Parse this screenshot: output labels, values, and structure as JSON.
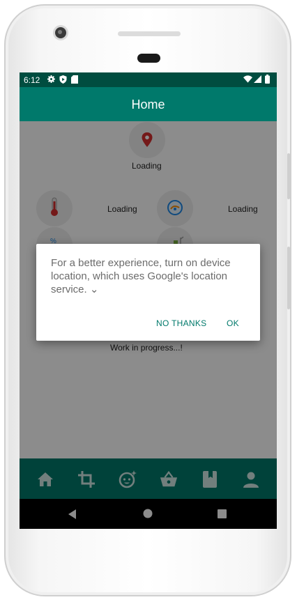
{
  "status_bar": {
    "time": "6:12"
  },
  "app_bar": {
    "title": "Home"
  },
  "location_tile": {
    "label": "Loading"
  },
  "sensors": [
    {
      "label": "Loading",
      "icon": "thermometer-icon"
    },
    {
      "label": "Loading",
      "icon": "air-quality-icon"
    }
  ],
  "footer_text": "Work in progress...!",
  "dialog": {
    "message": "For a better experience, turn on device location, which uses Google's location service.",
    "expand_glyph": "⌄",
    "no_thanks": "NO THANKS",
    "ok": "OK"
  },
  "bottom_nav": [
    "home-icon",
    "crop-icon",
    "baby-face-icon",
    "basket-icon",
    "book-icon",
    "person-icon"
  ],
  "colors": {
    "primary": "#00796b",
    "primary_dark": "#004d40",
    "accent_red": "#d32f2f"
  }
}
